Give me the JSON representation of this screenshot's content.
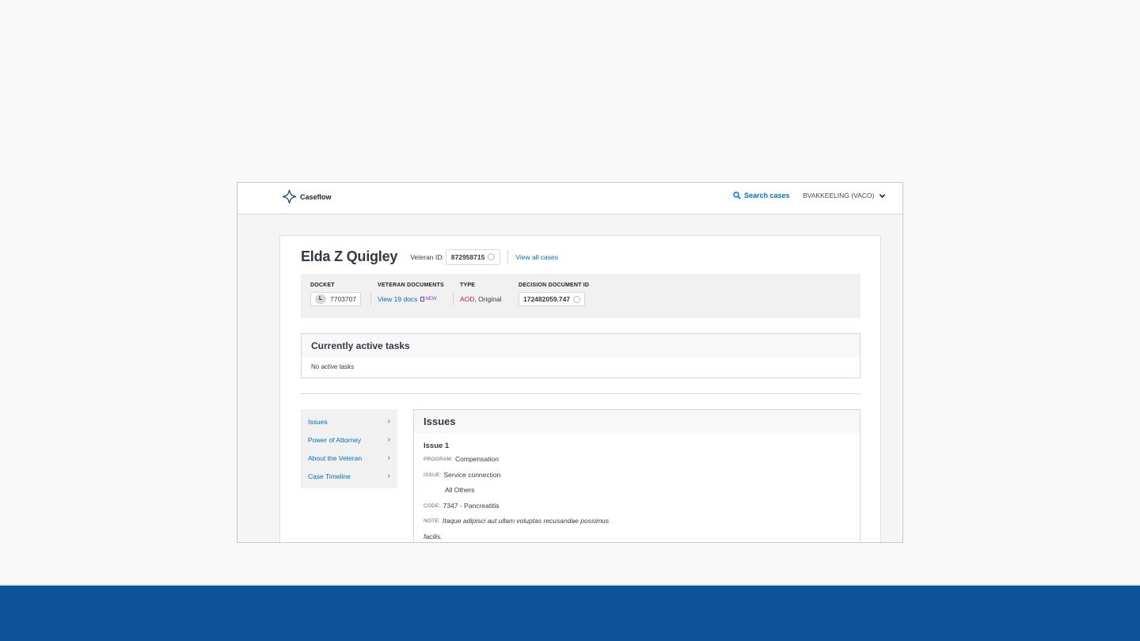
{
  "app": {
    "name": "Caseflow"
  },
  "header": {
    "search_label": "Search cases",
    "user_label": "BVAKKEELING (VACO)"
  },
  "veteran": {
    "name": "Elda Z Quigley",
    "id_label": "Veteran ID:",
    "id_value": "872958715",
    "view_all_cases": "View all cases"
  },
  "summary": {
    "docket_header": "DOCKET",
    "docket_badge": "L",
    "docket_number": "7703707",
    "docs_header": "VETERAN DOCUMENTS",
    "docs_link": "View 19 docs",
    "docs_new": "NEW",
    "type_header": "TYPE",
    "type_aod": "AOD",
    "type_rest": ", Original",
    "decision_header": "DECISION DOCUMENT ID",
    "decision_id": "172482059.747"
  },
  "tasks": {
    "title": "Currently active tasks",
    "empty": "No active tasks"
  },
  "sidenav": {
    "items": [
      {
        "label": "Issues"
      },
      {
        "label": "Power of Attorney"
      },
      {
        "label": "About the Veteran"
      },
      {
        "label": "Case Timeline"
      }
    ]
  },
  "issues": {
    "title": "Issues",
    "issue_title": "Issue 1",
    "program_label": "PROGRAM:",
    "program_value": "Compensation",
    "issue_label": "ISSUE:",
    "issue_value": "Service connection",
    "issue_sub": "All Others",
    "code_label": "CODE:",
    "code_value": "7347 - Pancreatitis",
    "note_label": "NOTE:",
    "note_line1": "Itaque adipisci aut ullam voluptas recusandae possimus",
    "note_line2": "facilis."
  },
  "colors": {
    "link": "#0071bc",
    "footer": "#0c5397",
    "aod": "#cd2026",
    "new_badge": "#7b3bbf"
  }
}
